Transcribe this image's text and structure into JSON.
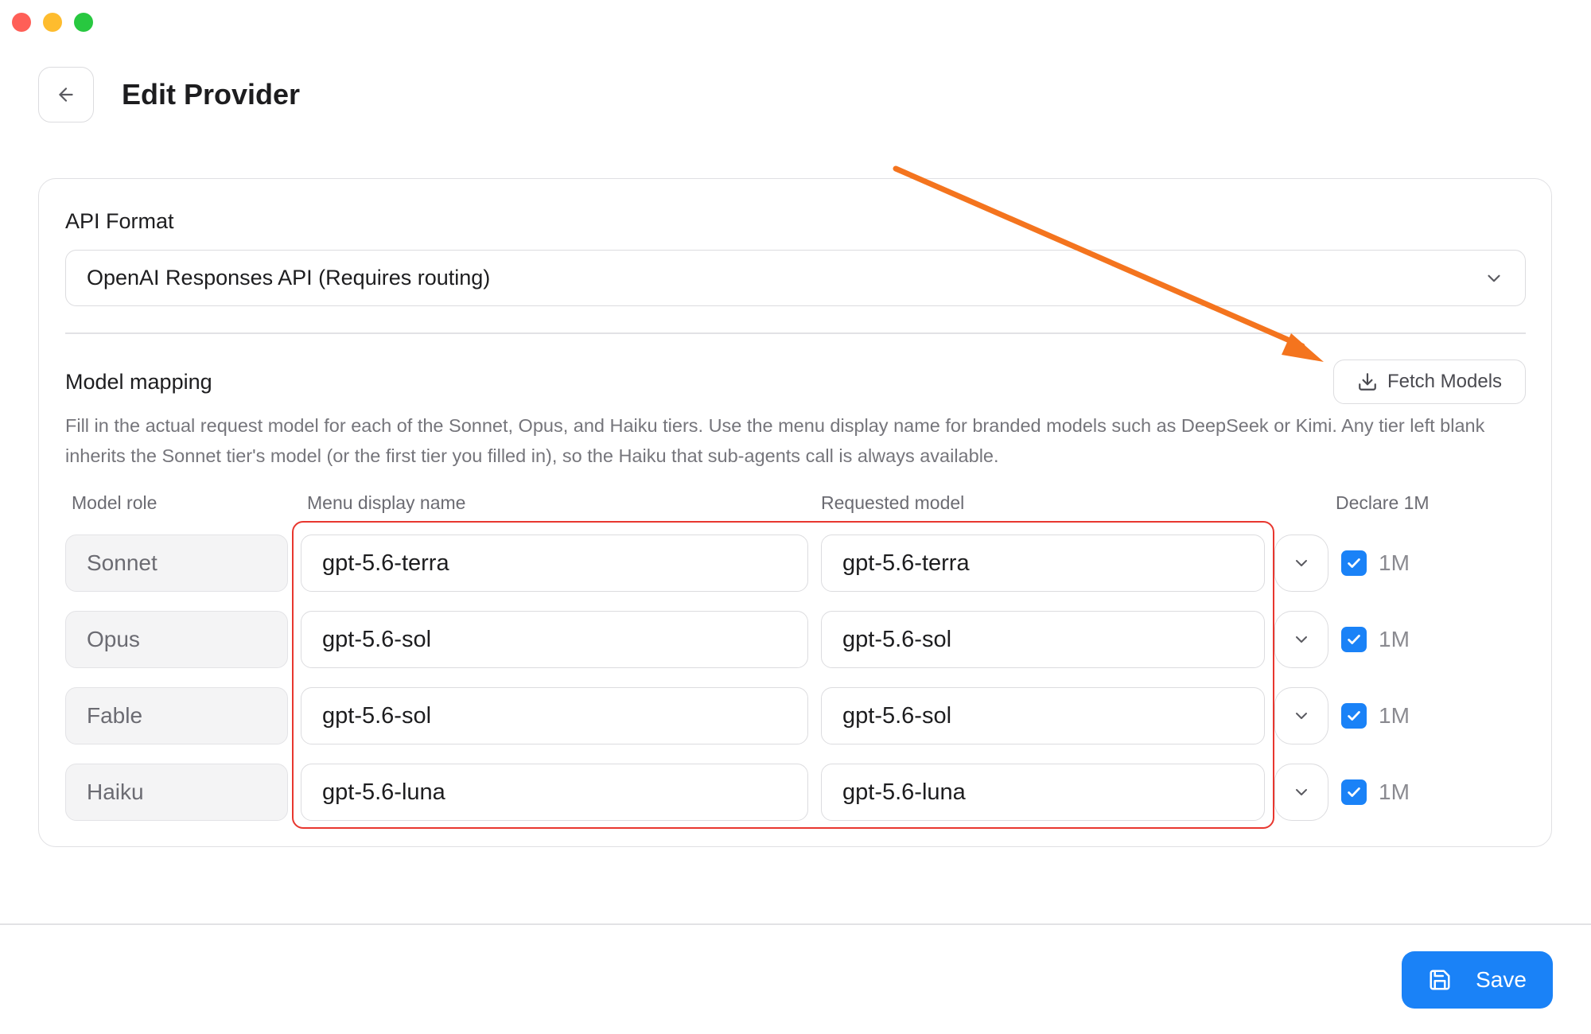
{
  "header": {
    "title": "Edit Provider"
  },
  "api_format": {
    "label": "API Format",
    "selected": "OpenAI Responses API (Requires routing)"
  },
  "model_mapping": {
    "label": "Model mapping",
    "fetch_button": "Fetch Models",
    "description": "Fill in the actual request model for each of the Sonnet, Opus, and Haiku tiers. Use the menu display name for branded models such as DeepSeek or Kimi. Any tier left blank inherits the Sonnet tier's model (or the first tier you filled in), so the Haiku that sub-agents call is always available.",
    "columns": {
      "role": "Model role",
      "display": "Menu display name",
      "requested": "Requested model",
      "declare": "Declare 1M"
    },
    "rows": [
      {
        "role": "Sonnet",
        "display": "gpt-5.6-terra",
        "requested": "gpt-5.6-terra",
        "declare_label": "1M",
        "checked": true
      },
      {
        "role": "Opus",
        "display": "gpt-5.6-sol",
        "requested": "gpt-5.6-sol",
        "declare_label": "1M",
        "checked": true
      },
      {
        "role": "Fable",
        "display": "gpt-5.6-sol",
        "requested": "gpt-5.6-sol",
        "declare_label": "1M",
        "checked": true
      },
      {
        "role": "Haiku",
        "display": "gpt-5.6-luna",
        "requested": "gpt-5.6-luna",
        "declare_label": "1M",
        "checked": true
      }
    ]
  },
  "footer": {
    "save_label": "Save"
  },
  "colors": {
    "accent": "#1a82f7",
    "highlight_box": "#e8372f",
    "annotation_arrow": "#f4741e"
  },
  "icons": [
    "back-arrow-icon",
    "chevron-down-icon",
    "download-icon",
    "checkmark-icon",
    "save-icon"
  ]
}
